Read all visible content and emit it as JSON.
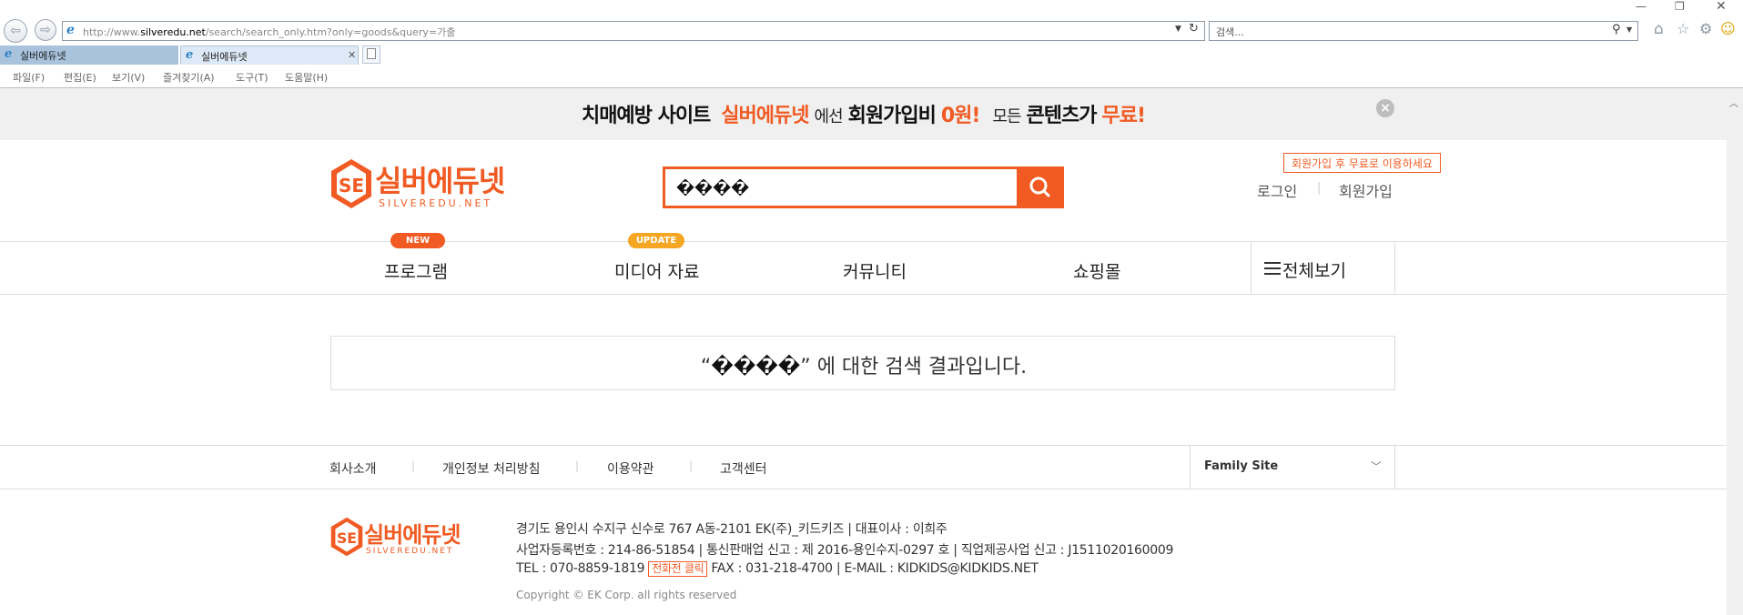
{
  "browser": {
    "url_prefix": "http://www.",
    "url_domain": "silveredu.net",
    "url_path": "/search/search_only.htm?only=goods&query=가출",
    "search_placeholder": "검색...",
    "tabs": [
      {
        "label": "실버에듀넷"
      },
      {
        "label": "실버에듀넷"
      }
    ],
    "menu": [
      "파일(F)",
      "편집(E)",
      "보기(V)",
      "즐겨찾기(A)",
      "도구(T)",
      "도움말(H)"
    ]
  },
  "banner": {
    "part1": "치매예방 사이트",
    "brand": "실버에듀넷",
    "part2": "에선",
    "part3": "회원가입비",
    "price": "0원!",
    "part4": "모든",
    "part5": "콘텐츠가",
    "free": "무료!"
  },
  "logo": {
    "main": "실버에듀넷",
    "sub": "SILVEREDU.NET",
    "mark": "SE"
  },
  "search": {
    "value": "����"
  },
  "account": {
    "tooltip": "회원가입 후 무료로 이용하세요",
    "login": "로그인",
    "separator": "|",
    "join": "회원가입"
  },
  "nav": {
    "items": [
      {
        "label": "프로그램",
        "badge": "NEW"
      },
      {
        "label": "미디어 자료",
        "badge": "UPDATE"
      },
      {
        "label": "커뮤니티"
      },
      {
        "label": "쇼핑몰"
      }
    ],
    "all_view": "전체보기"
  },
  "result": {
    "open_quote": "“",
    "query": "����",
    "close_quote": "”",
    "suffix": " 에 대한 검색 결과입니다."
  },
  "footer": {
    "links": [
      "회사소개",
      "개인정보 처리방침",
      "이용약관",
      "고객센터"
    ],
    "family_site": "Family Site",
    "address": "경기도 용인시 수지구 신수로 767 A동-2101 EK(주)_키드키즈 | 대표이사 : 이희주",
    "business": "사업자등록번호 : 214-86-51854 | 통신판매업 신고 : 제 2016-용인수지-0297 호 | 직업제공사업 신고 : J1511020160009",
    "tel": "TEL : 070-8859-1819",
    "call_badge": "전화전 클릭",
    "fax_email": "FAX : 031-218-4700 | E-MAIL : KIDKIDS@KIDKIDS.NET",
    "copyright": "Copyright © EK Corp. all rights reserved"
  },
  "colors": {
    "accent": "#f15a22",
    "badge_new": "#f15a22",
    "badge_update": "#f5a623"
  }
}
